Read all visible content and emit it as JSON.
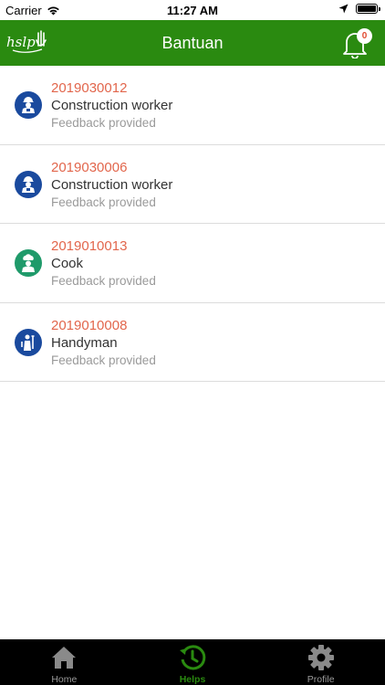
{
  "status_bar": {
    "carrier": "Carrier",
    "time": "11:27 AM"
  },
  "nav": {
    "title": "Bantuan",
    "logo_text": "hslp",
    "notification_count": "0",
    "color": "#2a8a10"
  },
  "requests": [
    {
      "id": "2019030012",
      "job": "Construction worker",
      "status": "Feedback provided",
      "icon": "construction-worker-icon",
      "icon_color": "#1a4a9e"
    },
    {
      "id": "2019030006",
      "job": "Construction worker",
      "status": "Feedback provided",
      "icon": "construction-worker-icon",
      "icon_color": "#1a4a9e"
    },
    {
      "id": "2019010013",
      "job": "Cook",
      "status": "Feedback provided",
      "icon": "cook-icon",
      "icon_color": "#1f9a6a"
    },
    {
      "id": "2019010008",
      "job": "Handyman",
      "status": "Feedback provided",
      "icon": "handyman-icon",
      "icon_color": "#1a4a9e"
    }
  ],
  "tabs": [
    {
      "label": "Home",
      "icon": "home-icon",
      "active": false
    },
    {
      "label": "Helps",
      "icon": "history-icon",
      "active": true
    },
    {
      "label": "Profile",
      "icon": "gear-icon",
      "active": false
    }
  ]
}
